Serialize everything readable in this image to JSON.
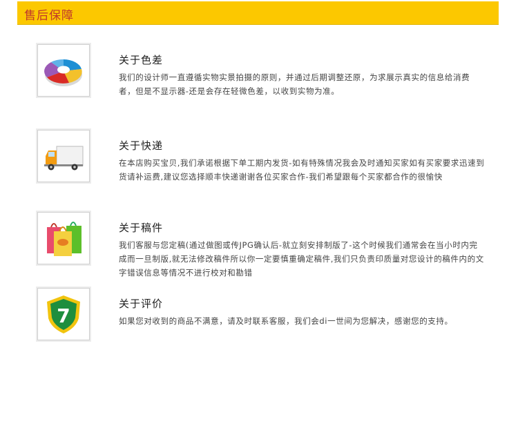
{
  "header": {
    "title": "售后保障"
  },
  "items": [
    {
      "title": "关于色差",
      "desc": "我们的设计师一直遵循实物实景拍摄的原则，并通过后期调整还原，为求展示真实的信息给消费者，但是不显示器-还是会存在轻微色差，以收到实物为准。",
      "icon": "pie-chart-icon"
    },
    {
      "title": "关于快递",
      "desc": "在本店购买宝贝,我们承诺根据下单工期内发货-如有特殊情况我会及时通知买家如有买家要求迅速到货请补运费,建议您选择顺丰快递谢谢各位买家合作-我们希望跟每个买家都合作的很愉快",
      "icon": "truck-icon"
    },
    {
      "title": "关于稿件",
      "desc": "我们客服与您定稿(通过做图或传JPG确认后-就立刻安排制版了-这个时候我们通常会在当小时内完成而一旦制版,就无法修改稿件所以你一定要慎重确定稿件,我们只负责印质量对您设计的稿件内的文字错误信息等情况不进行校对和勘错",
      "icon": "shopping-bags-icon"
    },
    {
      "title": "关于评价",
      "desc": "如果您对收到的商品不满意，请及时联系客服，我们会di一世间为您解决，感谢您的支持。",
      "icon": "shield-seven-icon",
      "badge_text": "7"
    }
  ],
  "colors": {
    "header_bg": "#fcc800",
    "header_text": "#c0392b"
  }
}
